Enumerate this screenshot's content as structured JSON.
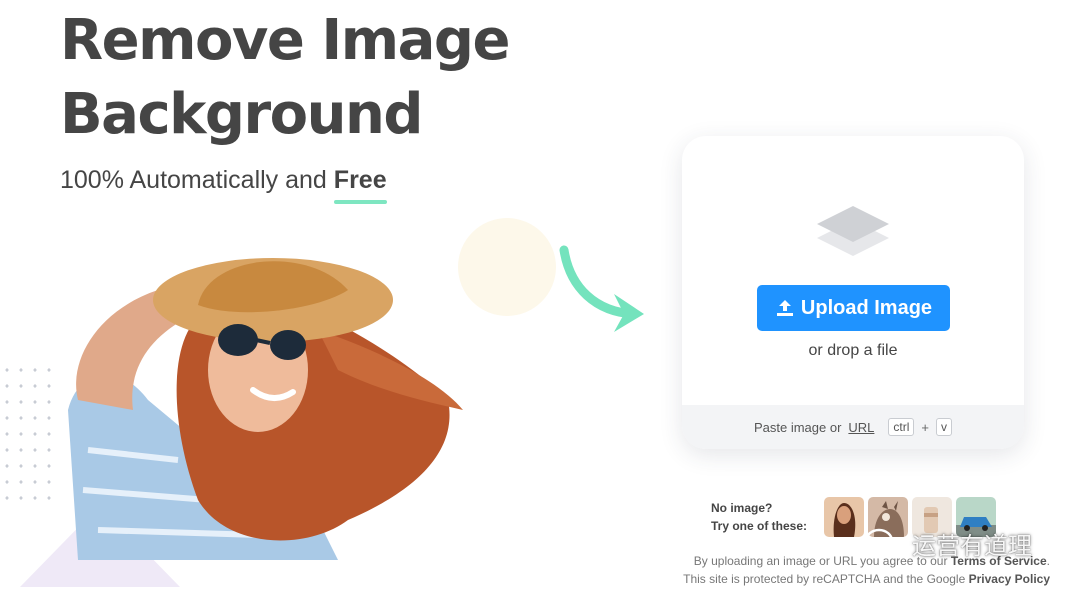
{
  "hero": {
    "title_line1": "Remove Image",
    "title_line2": "Background",
    "subtitle_prefix": "100% Automatically and",
    "subtitle_emphasis": "Free"
  },
  "upload": {
    "button_label": "Upload Image",
    "drop_text": "or drop a file",
    "paste_prefix": "Paste image or",
    "paste_link": "URL",
    "key_ctrl": "ctrl",
    "key_plus": "+",
    "key_v": "v"
  },
  "samples": {
    "line1": "No image?",
    "line2": "Try one of these:"
  },
  "legal": {
    "line1_prefix": "By uploading an image or URL you agree to our",
    "line1_link": "Terms of Service",
    "line1_suffix": ".",
    "line2_prefix": "This site is protected by reCAPTCHA and the Google",
    "line2_link": "Privacy Policy"
  },
  "watermark": {
    "text": "运营有道理"
  },
  "colors": {
    "accent_blue": "#1f93ff",
    "underline_mint": "#7ee6c1",
    "arrow_mint": "#74e3bd",
    "text_dark": "#454545"
  }
}
